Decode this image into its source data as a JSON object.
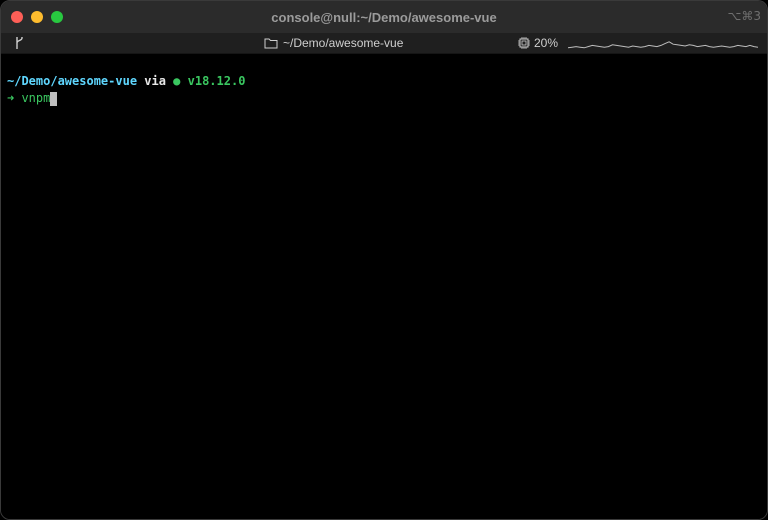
{
  "window": {
    "title": "console@null:~/Demo/awesome-vue",
    "shortcut": "⌥⌘3"
  },
  "statusbar": {
    "git_icon": "git-branch-icon",
    "path": "~/Demo/awesome-vue",
    "cpu_percent": "20%",
    "cpu_sparkline": [
      0.1,
      0.15,
      0.2,
      0.15,
      0.1,
      0.2,
      0.3,
      0.25,
      0.2,
      0.15,
      0.2,
      0.35,
      0.3,
      0.25,
      0.2,
      0.15,
      0.25,
      0.2,
      0.15,
      0.2,
      0.3,
      0.25,
      0.2,
      0.3,
      0.45,
      0.6,
      0.4,
      0.35,
      0.3,
      0.25,
      0.35,
      0.3,
      0.2,
      0.25,
      0.3,
      0.2,
      0.15,
      0.2,
      0.25,
      0.2,
      0.15,
      0.2,
      0.3,
      0.25,
      0.2,
      0.3,
      0.2,
      0.15
    ]
  },
  "terminal": {
    "prompt_path": "~/Demo/awesome-vue",
    "prompt_via": " via ",
    "node_glyph": "●",
    "node_version": " v18.12.0",
    "prompt_arrow": "➜",
    "command": " vnpm"
  },
  "colors": {
    "close": "#fe5f57",
    "minimize": "#febc2e",
    "maximize": "#28c840",
    "prompt_path": "#5fd7ff",
    "node": "#3ac760"
  }
}
